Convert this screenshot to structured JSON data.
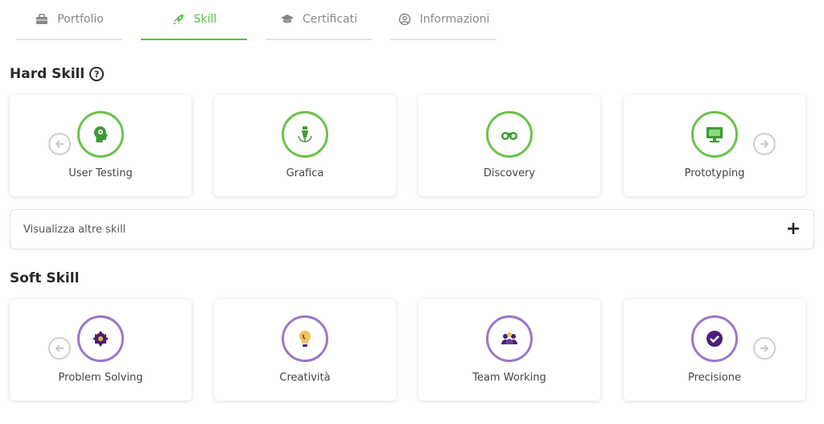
{
  "tabs": [
    {
      "label": "Portfolio",
      "icon": "briefcase-icon",
      "active": false
    },
    {
      "label": "Skill",
      "icon": "rocket-icon",
      "active": true
    },
    {
      "label": "Certificati",
      "icon": "graduation-cap-icon",
      "active": false
    },
    {
      "label": "Informazioni",
      "icon": "user-circle-icon",
      "active": false
    }
  ],
  "hard_skill": {
    "title": "Hard Skill",
    "help_glyph": "?",
    "cards": [
      {
        "label": "User Testing",
        "icon": "head-gear-icon"
      },
      {
        "label": "Grafica",
        "icon": "pen-tool-icon"
      },
      {
        "label": "Discovery",
        "icon": "binoculars-icon"
      },
      {
        "label": "Prototyping",
        "icon": "monitor-icon"
      }
    ],
    "more_label": "Visualizza altre skill",
    "more_glyph": "+"
  },
  "soft_skill": {
    "title": "Soft Skill",
    "cards": [
      {
        "label": "Problem Solving",
        "icon": "puzzle-icon"
      },
      {
        "label": "Creatività",
        "icon": "lightbulb-icon"
      },
      {
        "label": "Team Working",
        "icon": "team-icon"
      },
      {
        "label": "Precisione",
        "icon": "check-circle-icon"
      }
    ]
  },
  "colors": {
    "accent_green": "#5cbd4a",
    "soft_purple": "#9a78c8",
    "icon_purple": "#4a1f73"
  }
}
